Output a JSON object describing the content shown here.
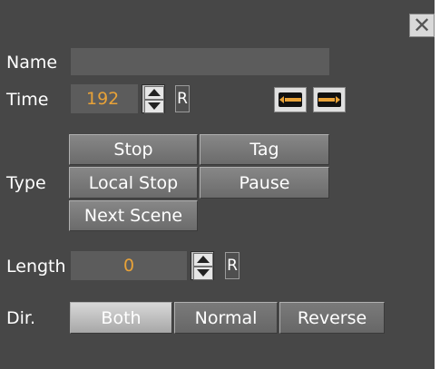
{
  "close_glyph": "✕",
  "name": {
    "label": "Name",
    "value": ""
  },
  "time": {
    "label": "Time",
    "value": "192",
    "reset_label": "R"
  },
  "type": {
    "label": "Type",
    "options": [
      "Stop",
      "Tag",
      "Local Stop",
      "Pause",
      "Next Scene"
    ]
  },
  "length": {
    "label": "Length",
    "value": "0",
    "reset_label": "R"
  },
  "dir": {
    "label": "Dir.",
    "options": [
      "Both",
      "Normal",
      "Reverse"
    ],
    "selected": "Both"
  },
  "colors": {
    "panel": "#474747",
    "value_text": "#e8a238",
    "selected_button": "#c4c4c4"
  }
}
